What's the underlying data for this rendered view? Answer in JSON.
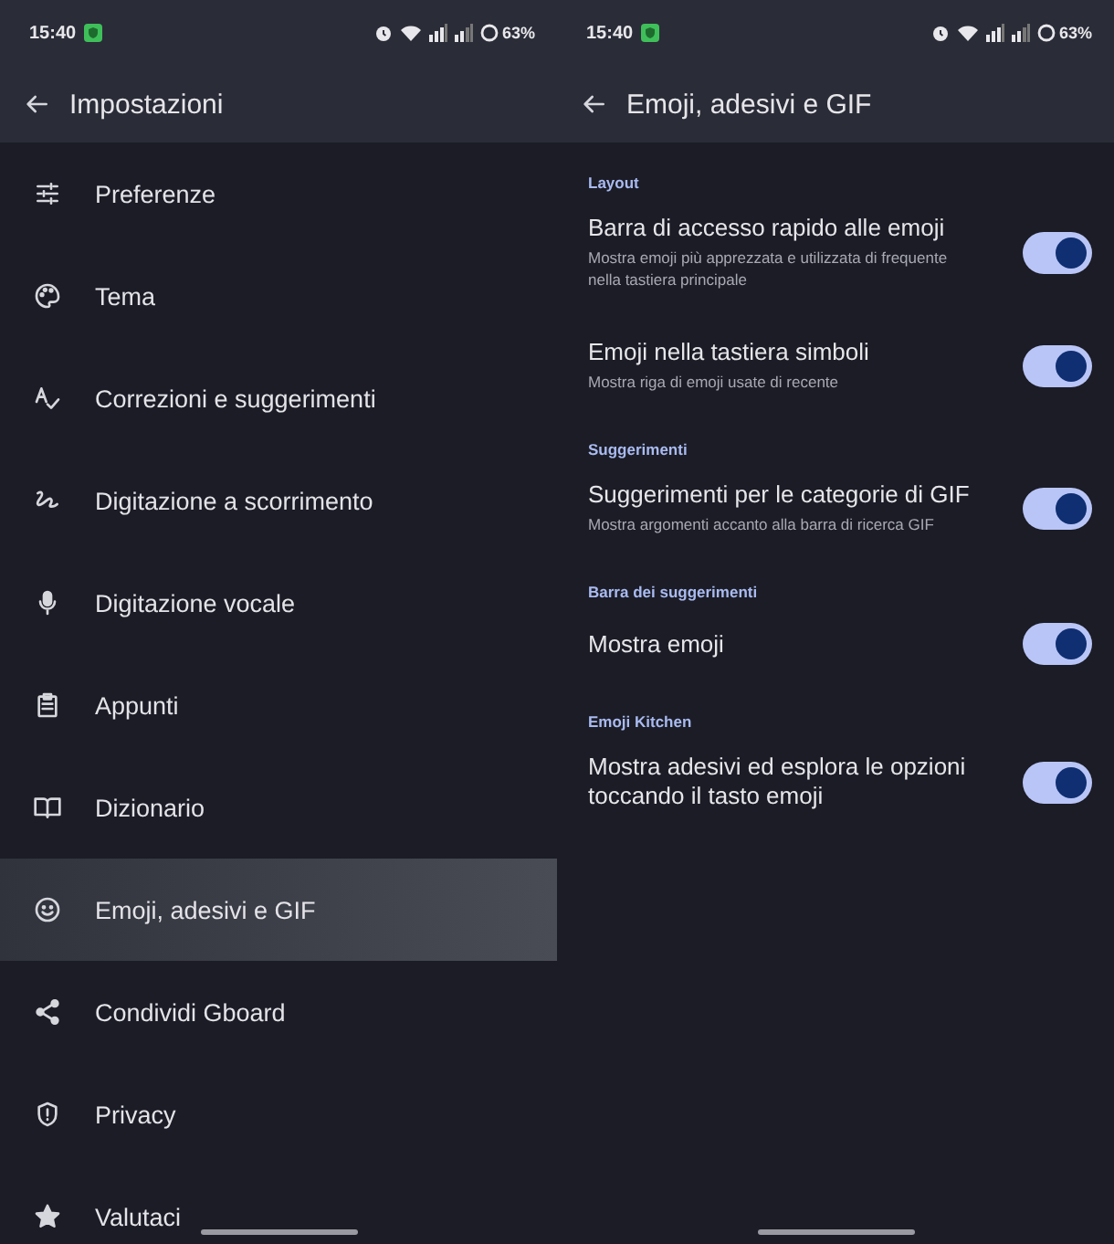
{
  "left_screen": {
    "status_bar": {
      "time": "15:40",
      "battery": "63%"
    },
    "app_bar": {
      "title": "Impostazioni"
    },
    "menu": [
      {
        "label": "Preferenze",
        "selected": false
      },
      {
        "label": "Tema",
        "selected": false
      },
      {
        "label": "Correzioni e suggerimenti",
        "selected": false
      },
      {
        "label": "Digitazione a scorrimento",
        "selected": false
      },
      {
        "label": "Digitazione vocale",
        "selected": false
      },
      {
        "label": "Appunti",
        "selected": false
      },
      {
        "label": "Dizionario",
        "selected": false
      },
      {
        "label": "Emoji, adesivi e GIF",
        "selected": true
      },
      {
        "label": "Condividi Gboard",
        "selected": false
      },
      {
        "label": "Privacy",
        "selected": false
      },
      {
        "label": "Valutaci",
        "selected": false
      }
    ]
  },
  "right_screen": {
    "status_bar": {
      "time": "15:40",
      "battery": "63%"
    },
    "app_bar": {
      "title": "Emoji, adesivi e GIF"
    },
    "sections": [
      {
        "header": "Layout",
        "settings": [
          {
            "title": "Barra di accesso rapido alle emoji",
            "subtitle": "Mostra emoji più apprezzata e utilizzata di frequente nella tastiera principale",
            "on": true
          },
          {
            "title": "Emoji nella tastiera simboli",
            "subtitle": "Mostra riga di emoji usate di recente",
            "on": true
          }
        ]
      },
      {
        "header": "Suggerimenti",
        "settings": [
          {
            "title": "Suggerimenti per le categorie di GIF",
            "subtitle": "Mostra argomenti accanto alla barra di ricerca GIF",
            "on": true
          }
        ]
      },
      {
        "header": "Barra dei suggerimenti",
        "settings": [
          {
            "title": "Mostra emoji",
            "on": true
          }
        ]
      },
      {
        "header": "Emoji Kitchen",
        "settings": [
          {
            "title": "Mostra adesivi ed esplora le opzioni toccando il tasto emoji",
            "on": true
          }
        ]
      }
    ]
  }
}
